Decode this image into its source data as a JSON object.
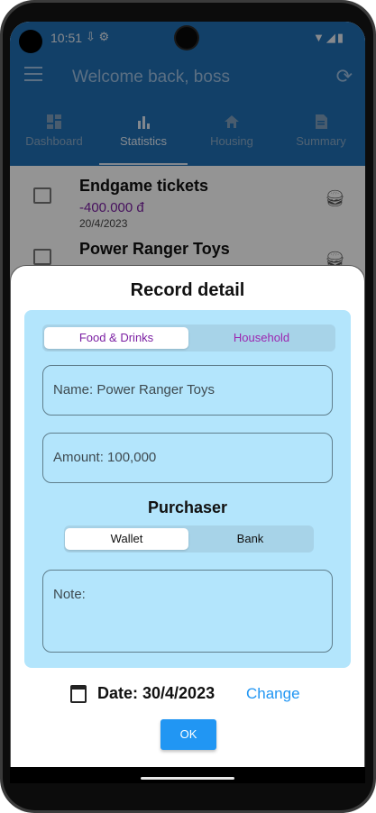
{
  "status": {
    "time": "10:51",
    "left_icons": "⇩ ⚙",
    "right_icons": "▼◢▮"
  },
  "app": {
    "title": "Welcome back, boss"
  },
  "tabs": [
    {
      "label": "Dashboard",
      "icon": "dashboard-icon"
    },
    {
      "label": "Statistics",
      "icon": "bar-chart-icon",
      "active": true
    },
    {
      "label": "Housing",
      "icon": "house-icon"
    },
    {
      "label": "Summary",
      "icon": "summary-icon"
    }
  ],
  "records": [
    {
      "name": "Endgame tickets",
      "amount": "-400.000 đ",
      "date": "20/4/2023"
    },
    {
      "name": "Power Ranger Toys"
    }
  ],
  "dialog": {
    "title": "Record detail",
    "category": {
      "options": [
        "Food & Drinks",
        "Household"
      ],
      "selected": "Food & Drinks"
    },
    "name_field": "Name: Power Ranger Toys",
    "amount_field": "Amount: 100,000",
    "purchaser_heading": "Purchaser",
    "purchaser": {
      "options": [
        "Wallet",
        "Bank"
      ],
      "selected": "Wallet"
    },
    "note_field": "Note:",
    "date_label": "Date: 30/4/2023",
    "change_label": "Change",
    "ok_label": "OK"
  },
  "colors": {
    "appbar": "#1f6fb4",
    "panel": "#b3e5fc",
    "accent": "#2196f3",
    "category_text": "#7b1fa2",
    "amount_negative": "#7b1fa2"
  }
}
